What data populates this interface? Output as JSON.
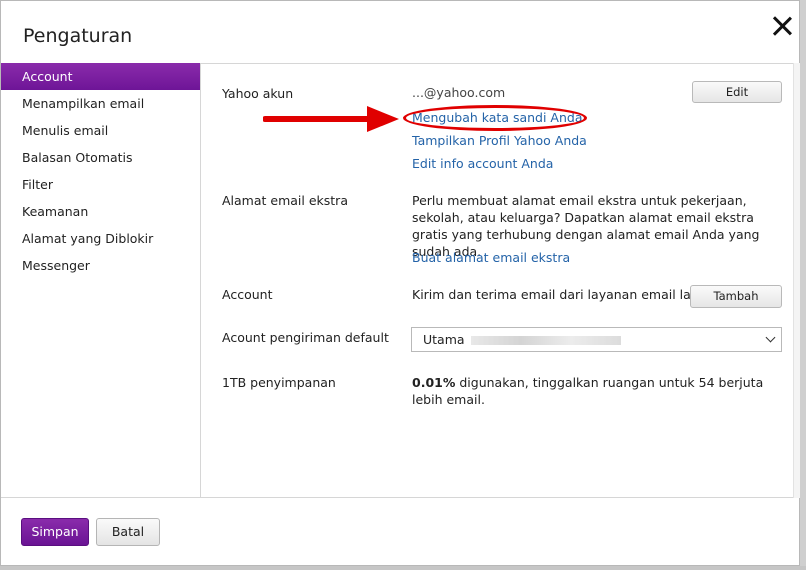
{
  "dialog": {
    "title": "Pengaturan"
  },
  "sidebar": {
    "items": [
      {
        "label": "Account"
      },
      {
        "label": "Menampilkan email"
      },
      {
        "label": "Menulis email"
      },
      {
        "label": "Balasan Otomatis"
      },
      {
        "label": "Filter"
      },
      {
        "label": "Keamanan"
      },
      {
        "label": "Alamat yang Diblokir"
      },
      {
        "label": "Messenger"
      }
    ]
  },
  "account": {
    "yahoo": {
      "label": "Yahoo akun",
      "email": "...@yahoo.com",
      "edit_button": "Edit",
      "links": {
        "change_password": "Mengubah kata sandi Anda",
        "show_profile": "Tampilkan Profil Yahoo Anda",
        "edit_info": "Edit info account Anda"
      }
    },
    "extra_email": {
      "label": "Alamat email ekstra",
      "description": "Perlu membuat alamat email ekstra untuk pekerjaan, sekolah, atau keluarga? Dapatkan alamat email ekstra gratis yang terhubung dengan alamat email Anda yang sudah ada.",
      "link": "Buat alamat email ekstra"
    },
    "other_account": {
      "label": "Account",
      "description": "Kirim dan terima email dari layanan email lain",
      "button": "Tambah"
    },
    "default_sending": {
      "label": "Acount pengiriman default",
      "selected": "Utama"
    },
    "storage": {
      "label": "1TB penyimpanan",
      "percent": "0.01%",
      "description": " digunakan, tinggalkan ruangan untuk 54 berjuta lebih email."
    }
  },
  "footer": {
    "save_label": "Simpan",
    "cancel_label": "Batal"
  },
  "annotation": {
    "color": "#e00000"
  }
}
